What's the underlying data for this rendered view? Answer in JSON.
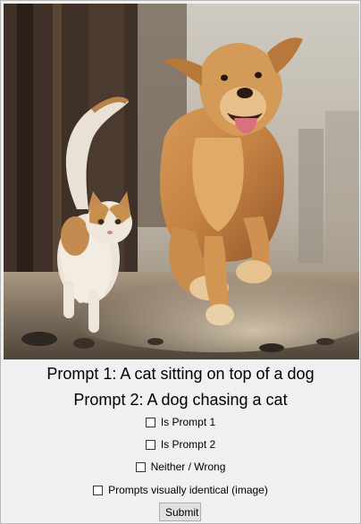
{
  "image": {
    "icon": "photo-icon"
  },
  "prompts": {
    "prompt1": "Prompt 1: A cat sitting on top of a dog",
    "prompt2": "Prompt 2: A dog chasing a cat"
  },
  "options": [
    {
      "label": "Is Prompt 1",
      "checked": false
    },
    {
      "label": "Is Prompt 2",
      "checked": false
    },
    {
      "label": "Neither / Wrong",
      "checked": false
    },
    {
      "label": "Prompts visually identical (image)",
      "checked": false
    }
  ],
  "submit_label": "Submit"
}
